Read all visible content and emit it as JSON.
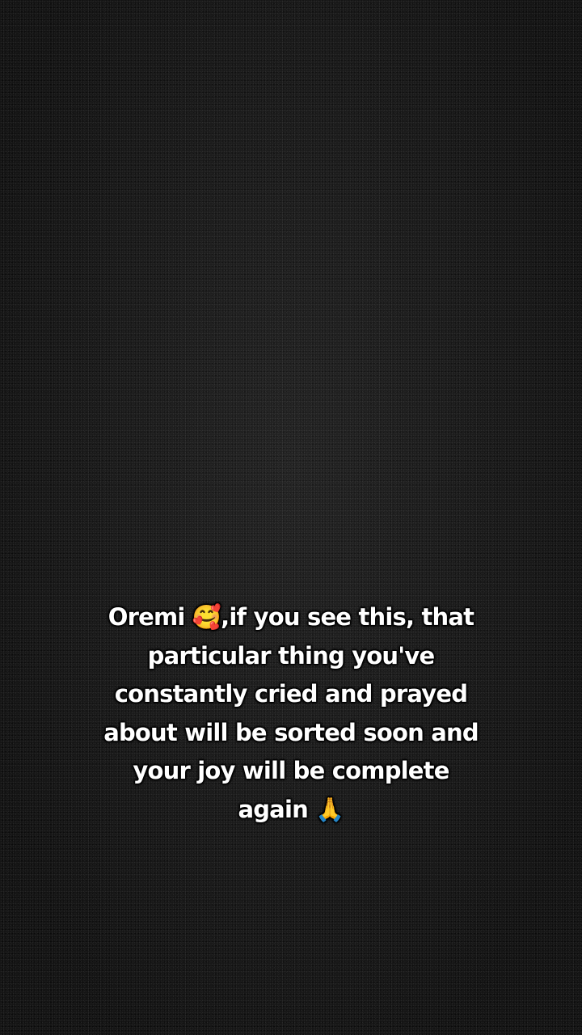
{
  "caption": {
    "lines": [
      {
        "before": "Oremi ",
        "emoji": "🥰",
        "after": ",if you see this, that"
      },
      {
        "text": "particular thing you've"
      },
      {
        "text": "constantly cried and prayed"
      },
      {
        "text": "about will be sorted soon and"
      },
      {
        "text": "your joy will be complete"
      },
      {
        "before": "again ",
        "emoji": "🙏",
        "after": ""
      }
    ]
  },
  "icons": {
    "smiling_face_with_hearts": "smiling-face-with-hearts-icon",
    "folded_hands": "folded-hands-icon"
  }
}
